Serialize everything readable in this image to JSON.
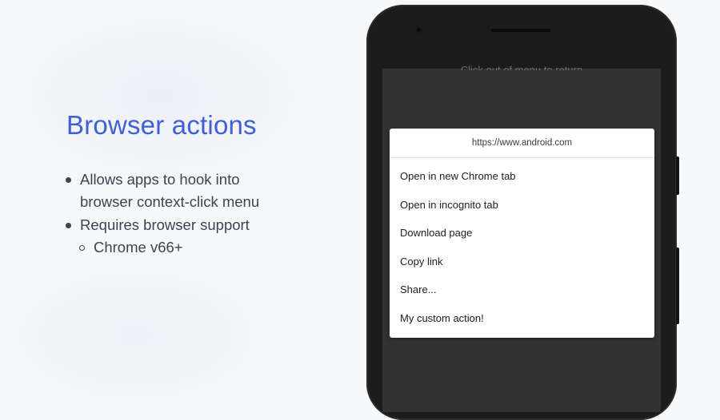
{
  "slide": {
    "title": "Browser actions",
    "bullets": [
      "Allows apps to hook into",
      "browser context-click menu",
      "Requires browser support",
      "Chrome v66+"
    ]
  },
  "phone": {
    "screen_top_text": "Click out of menu to return",
    "dialog": {
      "url": "https://www.android.com",
      "items": [
        "Open in new Chrome tab",
        "Open in incognito tab",
        "Download page",
        "Copy link",
        "Share...",
        "My custom action!"
      ]
    }
  },
  "colors": {
    "title": "#3f5fd6",
    "text": "#3b4354",
    "phone_body": "#1c1c1c",
    "screen": "#323232",
    "dialog_bg": "#ffffff"
  }
}
